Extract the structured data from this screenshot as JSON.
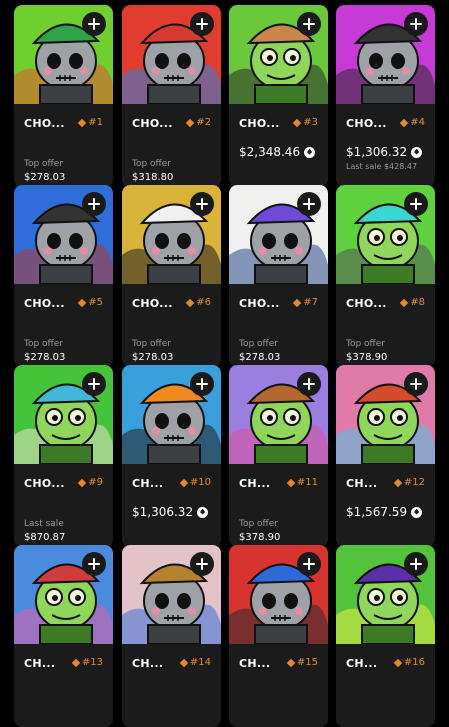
{
  "cards": [
    {
      "name": "CHO...",
      "rank": "#1",
      "label": "Top offer",
      "value": "$278.03",
      "bg": "#6fcf2f",
      "figure": "skull",
      "hat": "#2fa34a",
      "accent": "#e9552f"
    },
    {
      "name": "CHO...",
      "rank": "#2",
      "label": "Top offer",
      "value": "$318.80",
      "bg": "#e03c2f",
      "figure": "skull",
      "hat": "#d63a2e",
      "accent": "#2d7fd8"
    },
    {
      "name": "CHO...",
      "rank": "#3",
      "price": "$2,348.46",
      "bg": "#69c93a",
      "figure": "frog",
      "hat": "#c98848",
      "accent": "#2b2b2b"
    },
    {
      "name": "CHO...",
      "rank": "#4",
      "price": "$1,306.32",
      "small": "Last sale $428.47",
      "bg": "#c63ad6",
      "figure": "skull",
      "hat": "#333",
      "accent": "#2b2b2b"
    },
    {
      "name": "CHO...",
      "rank": "#5",
      "label": "Top offer",
      "value": "$278.03",
      "bg": "#2f6ddb",
      "figure": "skull",
      "hat": "#333",
      "accent": "#b23a2b"
    },
    {
      "name": "CHO...",
      "rank": "#6",
      "label": "Top offer",
      "value": "$278.03",
      "bg": "#d9b43a",
      "figure": "skull",
      "hat": "#f0f0f0",
      "accent": "#1e1e1e"
    },
    {
      "name": "CHO...",
      "rank": "#7",
      "label": "Top offer",
      "value": "$278.03",
      "bg": "#f0f0ef",
      "figure": "skull",
      "hat": "#6d4ad8",
      "accent": "#2a4c8c"
    },
    {
      "name": "CHO...",
      "rank": "#8",
      "label": "Top offer",
      "value": "$378.90",
      "bg": "#5fd13f",
      "figure": "frog",
      "hat": "#3ad6d0",
      "accent": "#555"
    },
    {
      "name": "CHO...",
      "rank": "#9",
      "label": "Last sale",
      "value": "$870.87",
      "bg": "#45c43a",
      "figure": "frog",
      "hat": "#42b8d8",
      "accent": "#e9e2c9"
    },
    {
      "name": "CH...",
      "rank": "#10",
      "price": "$1,306.32",
      "bg": "#3aa0dc",
      "figure": "skull",
      "hat": "#f08a1e",
      "accent": "#222"
    },
    {
      "name": "CH...",
      "rank": "#11",
      "label": "Top offer",
      "value": "$378.90",
      "bg": "#9a7fe0",
      "figure": "frog",
      "hat": "#b4672f",
      "accent": "#e04f9d"
    },
    {
      "name": "CH...",
      "rank": "#12",
      "price": "$1,567.59",
      "bg": "#e07aa8",
      "figure": "frog",
      "hat": "#d64b2a",
      "accent": "#48c4e0"
    },
    {
      "name": "CH...",
      "rank": "#13",
      "bg": "#4a8be0",
      "figure": "frog",
      "hat": "#d03b3b",
      "accent": "#e05fa8"
    },
    {
      "name": "CH...",
      "rank": "#14",
      "bg": "#e3c3c8",
      "figure": "skull",
      "hat": "#b4812f",
      "accent": "#3a6fd8"
    },
    {
      "name": "CH...",
      "rank": "#15",
      "bg": "#d8342f",
      "figure": "skull",
      "hat": "#2f68d8",
      "accent": "#2b2b2b"
    },
    {
      "name": "CH...",
      "rank": "#16",
      "bg": "#52c33a",
      "figure": "frog",
      "hat": "#5a2fa8",
      "accent": "#e8ec49"
    }
  ]
}
